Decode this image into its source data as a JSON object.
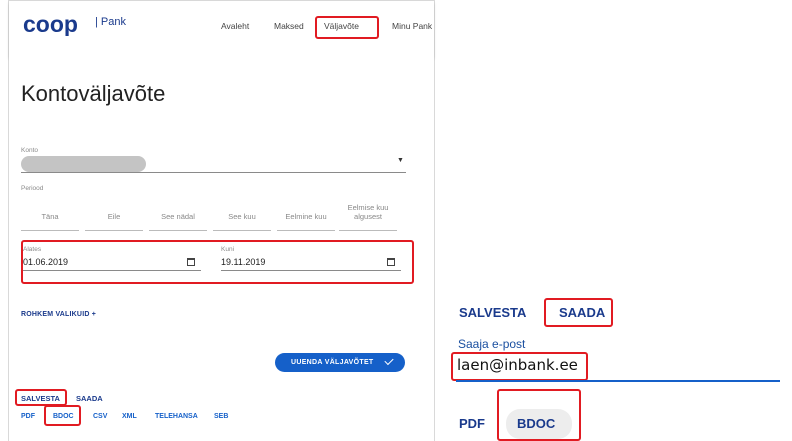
{
  "brand": {
    "logo_text": "coop",
    "product": "| Pank"
  },
  "nav": {
    "items": [
      "Avaleht",
      "Maksed",
      "Väljavõte",
      "Minu Pank"
    ]
  },
  "page": {
    "title": "Kontoväljavõte"
  },
  "form": {
    "account_label": "Konto",
    "period_label": "Periood",
    "periods": [
      "Täna",
      "Eile",
      "See nädal",
      "See kuu",
      "Eelmine kuu",
      "Eelmise kuu algusest"
    ],
    "from_label": "Alates",
    "from_value": "01.06.2019",
    "to_label": "Kuni",
    "to_value": "19.11.2019",
    "more_options": "ROHKEM VALIKUID +",
    "refresh_button": "UUENDA VÄLJAVÕTET"
  },
  "actions": {
    "save": "SALVESTA",
    "send": "SAADA"
  },
  "formats": [
    "PDF",
    "BDOC",
    "CSV",
    "XML",
    "TELEHANSA",
    "SEB"
  ],
  "zoom": {
    "save": "SALVESTA",
    "send": "SAADA",
    "email_label": "Saaja e-post",
    "email_value": "laen@inbank.ee",
    "fmt_pdf": "PDF",
    "fmt_bdoc": "BDOC"
  },
  "colors": {
    "brand_blue": "#1a3a8c",
    "accent_blue": "#1560c9",
    "highlight_red": "#e11b22"
  }
}
